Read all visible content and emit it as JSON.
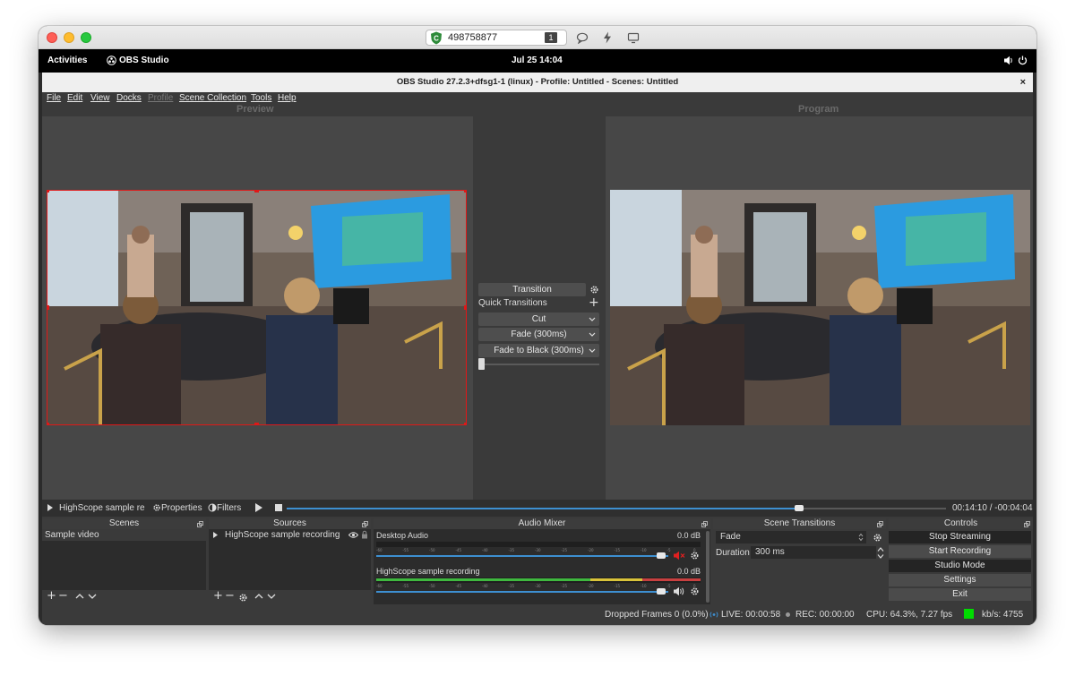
{
  "vnc": {
    "session_id": "498758877",
    "monitor_num": "1"
  },
  "gnome": {
    "activities": "Activities",
    "app_name": "OBS Studio",
    "datetime": "Jul 25  14:04"
  },
  "obs": {
    "window_title": "OBS Studio 27.2.3+dfsg1-1 (linux) - Profile: Untitled - Scenes: Untitled",
    "close_glyph": "×",
    "menu": {
      "file": "File",
      "edit": "Edit",
      "view": "View",
      "docks": "Docks",
      "profile": "Profile",
      "scene_collection": "Scene Collection",
      "tools": "Tools",
      "help": "Help"
    },
    "preview_label": "Preview",
    "program_label": "Program",
    "transition_panel": {
      "transition_button": "Transition",
      "quick_transitions_label": "Quick Transitions",
      "items": [
        "Cut",
        "Fade (300ms)",
        "Fade to Black (300ms)"
      ],
      "t_bar_value": 0
    },
    "media_bar": {
      "source_name": "HighScope sample re",
      "properties": "Properties",
      "filters": "Filters",
      "time_display": "00:14:10 / -00:04:04",
      "progress": 0.7768
    },
    "docks": {
      "scenes": {
        "title": "Scenes",
        "items": [
          "Sample video"
        ]
      },
      "sources": {
        "title": "Sources",
        "items": [
          "HighScope sample recording"
        ]
      },
      "audio_mixer": {
        "title": "Audio Mixer",
        "channels": [
          {
            "name": "Desktop Audio",
            "level": "0.0 dB",
            "muted": true,
            "volume": 0.99,
            "meter_green": 0,
            "meter_yellow": 0,
            "meter_red": 0
          },
          {
            "name": "HighScope sample recording",
            "level": "0.0 dB",
            "muted": false,
            "volume": 0.99,
            "meter_green": 0.66,
            "meter_yellow": 0.16,
            "meter_red": 0.18
          }
        ],
        "scale_ticks": [
          "-60",
          "-55",
          "-50",
          "-45",
          "-40",
          "-35",
          "-30",
          "-25",
          "-20",
          "-15",
          "-10",
          "-5",
          "0"
        ]
      },
      "scene_transitions": {
        "title": "Scene Transitions",
        "transition": "Fade",
        "duration_label": "Duration",
        "duration_value": "300 ms"
      },
      "controls": {
        "title": "Controls",
        "buttons": [
          "Stop Streaming",
          "Start Recording",
          "Studio Mode",
          "Settings",
          "Exit"
        ]
      }
    },
    "status": {
      "dropped_frames": "Dropped Frames 0 (0.0%)",
      "live": "LIVE: 00:00:58",
      "rec": "REC: 00:00:00",
      "cpu": "CPU: 64.3%, 7.27 fps",
      "bitrate": "kb/s: 4755"
    },
    "colors": {
      "accent": "#3d8fd1",
      "selection_red": "#e01818",
      "stream_ok": "#00dc00"
    }
  }
}
